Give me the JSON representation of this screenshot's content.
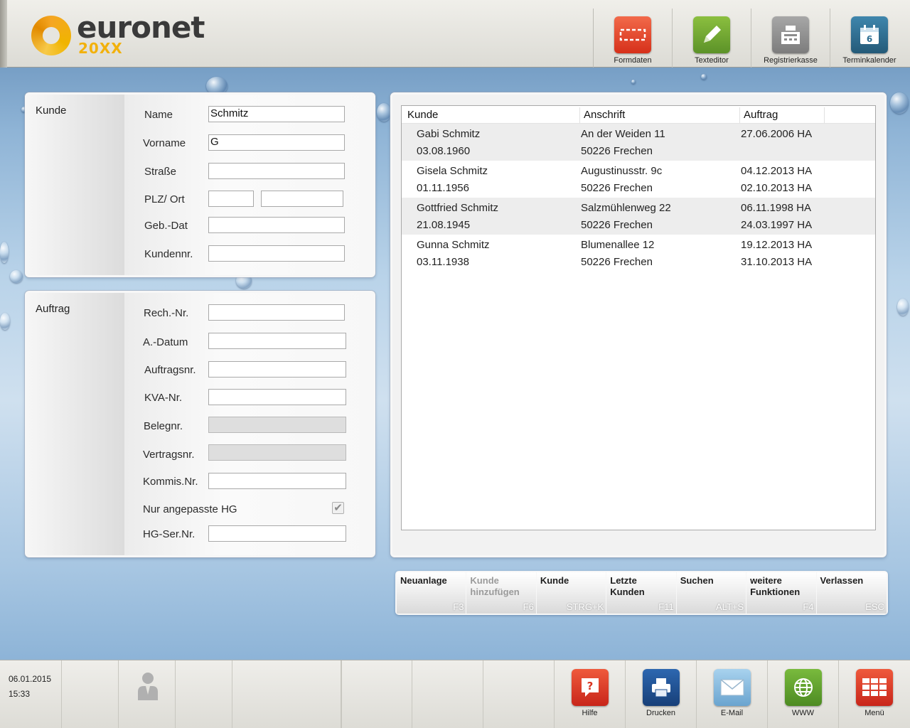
{
  "app": {
    "logo_text": "euronet",
    "logo_version": "20XX"
  },
  "toolbar": [
    {
      "label": "Formdaten",
      "icon": "formdata-icon",
      "color": "#e8402a"
    },
    {
      "label": "Texteditor",
      "icon": "pencil-icon",
      "color": "#6fa431"
    },
    {
      "label": "Registrierkasse",
      "icon": "cash-register-icon",
      "color": "#8c8c8c"
    },
    {
      "label": "Terminkalender",
      "icon": "calendar-icon",
      "color": "#2f6f93"
    }
  ],
  "kunde": {
    "title": "Kunde",
    "name_label": "Name",
    "name_value": "Schmitz",
    "vorname_label": "Vorname",
    "vorname_value": "G",
    "strasse_label": "Straße",
    "strasse_value": "",
    "plzort_label": "PLZ/ Ort",
    "plz_value": "",
    "ort_value": "",
    "gebdat_label": "Geb.-Dat",
    "gebdat_value": "",
    "kundennr_label": "Kundennr.",
    "kundennr_value": ""
  },
  "auftrag": {
    "title": "Auftrag",
    "rechnr_label": "Rech.-Nr.",
    "adatum_label": "A.-Datum",
    "auftragsnr_label": "Auftragsnr.",
    "kvanr_label": "KVA-Nr.",
    "belegnr_label": "Belegnr.",
    "vertragsnr_label": "Vertragsnr.",
    "kommisnr_label": "Kommis.Nr.",
    "nur_hg_label": "Nur angepasste HG",
    "nur_hg_checked": true,
    "hgsernr_label": "HG-Ser.Nr."
  },
  "results": {
    "columns": [
      "Kunde",
      "Anschrift",
      "Auftrag"
    ],
    "rows": [
      {
        "name": "Gabi Schmitz",
        "birth": "03.08.1960",
        "street": "An der Weiden 11",
        "city": "50226 Frechen",
        "order1": "27.06.2006 HA",
        "order2": ""
      },
      {
        "name": "Gisela Schmitz",
        "birth": "01.11.1956",
        "street": "Augustinusstr. 9c",
        "city": "50226 Frechen",
        "order1": "04.12.2013 HA",
        "order2": "02.10.2013 HA"
      },
      {
        "name": "Gottfried Schmitz",
        "birth": "21.08.1945",
        "street": "Salzmühlenweg 22",
        "city": "50226 Frechen",
        "order1": "06.11.1998 HA",
        "order2": "24.03.1997 HA"
      },
      {
        "name": "Gunna Schmitz",
        "birth": "03.11.1938",
        "street": "Blumenallee 12",
        "city": "50226 Frechen",
        "order1": "19.12.2013 HA",
        "order2": "31.10.2013 HA"
      }
    ]
  },
  "functions": [
    {
      "label1": "Neuanlage",
      "label2": "",
      "key": "F3",
      "enabled": true
    },
    {
      "label1": "Kunde",
      "label2": "hinzufügen",
      "key": "F6",
      "enabled": false
    },
    {
      "label1": "Kunde",
      "label2": "",
      "key": "STRG+K",
      "enabled": true
    },
    {
      "label1": "Letzte",
      "label2": "Kunden",
      "key": "F11",
      "enabled": true
    },
    {
      "label1": "Suchen",
      "label2": "",
      "key": "ALT+S",
      "enabled": true
    },
    {
      "label1": "weitere",
      "label2": "Funktionen",
      "key": "F4",
      "enabled": true
    },
    {
      "label1": "Verlassen",
      "label2": "",
      "key": "ESC",
      "enabled": true
    }
  ],
  "status": {
    "date": "06.01.2015",
    "time": "15:33"
  },
  "bottom_buttons": [
    {
      "label": "Hilfe",
      "icon": "help-icon",
      "color": "#d9331f"
    },
    {
      "label": "Drucken",
      "icon": "printer-icon",
      "color": "#1f4f8f"
    },
    {
      "label": "E-Mail",
      "icon": "mail-icon",
      "color": "#7fb6dc"
    },
    {
      "label": "WWW",
      "icon": "globe-icon",
      "color": "#5fa32d"
    },
    {
      "label": "Menü",
      "icon": "menu-grid-icon",
      "color": "#d9331f"
    }
  ]
}
